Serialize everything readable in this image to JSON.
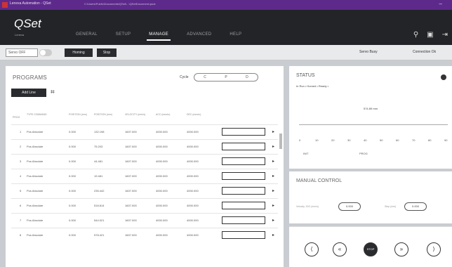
{
  "window": {
    "title": "Lenexa Automation - QSet",
    "path": "C:\\Users\\Public\\Documents\\QSet\\...\\QSetDocument.qsdx",
    "minimize": "–"
  },
  "header": {
    "logo": "QSet",
    "logo_sub": "Lenexa",
    "nav": [
      "GENERAL",
      "SETUP",
      "MANAGE",
      "ADVANCED",
      "HELP"
    ],
    "nav_active": "MANAGE"
  },
  "toolbar": {
    "servo": "Servo OFF",
    "buttons": [
      "Homing",
      "Stop"
    ],
    "servo_status": "Servo Busy",
    "connection": "Connection Ok"
  },
  "programs": {
    "title": "PROGRAMS",
    "cycle_label": "Cycle",
    "cycle_options": [
      "C",
      "P",
      "D"
    ],
    "add_button": "Add Line",
    "columns": [
      "PROG",
      "TYPE COMMAND",
      "POSITION (mm)",
      "POSITION (mm)",
      "VELOCITY (mm/s)",
      "ACC (mm/s²)",
      "DEC (mm/s²)"
    ],
    "rows": [
      [
        "1",
        "Pos Absolute",
        "0.000",
        "132.198",
        "1607.000",
        "4000.000",
        "4000.000"
      ],
      [
        "2",
        "Pos Absolute",
        "0.000",
        "75.203",
        "1607.000",
        "4000.000",
        "4000.000"
      ],
      [
        "3",
        "Pos Absolute",
        "0.000",
        "44.481",
        "1607.000",
        "4000.000",
        "4000.000"
      ],
      [
        "4",
        "Pos Absolute",
        "0.000",
        "19.481",
        "1607.000",
        "4000.000",
        "4000.000"
      ],
      [
        "5",
        "Pos Absolute",
        "0.000",
        "235.442",
        "1607.000",
        "4000.000",
        "4000.000"
      ],
      [
        "6",
        "Pos Absolute",
        "0.000",
        "518.814",
        "1607.000",
        "4000.000",
        "4000.000"
      ],
      [
        "7",
        "Pos Absolute",
        "0.000",
        "544.021",
        "1607.000",
        "4000.000",
        "4000.000"
      ],
      [
        "8",
        "Pos Absolute",
        "0.000",
        "578.421",
        "1607.000",
        "4000.000",
        "4000.000"
      ]
    ]
  },
  "status": {
    "title": "STATUS",
    "line": "In Run  •  Homed  •  Ready  •",
    "position_label": "574.89 mm",
    "ticks": [
      "0",
      "10",
      "20",
      "30",
      "40",
      "50",
      "60",
      "70",
      "80",
      "90"
    ],
    "legend_left": "INIT",
    "legend_right": "PROG"
  },
  "manual": {
    "title": "MANUAL CONTROL",
    "label_1": "Velocity JOG (mm/s)",
    "value_1": "0.000",
    "label_2": "Step (mm)",
    "value_2": "0.000"
  },
  "jog": {
    "buttons": [
      "⟨",
      "«",
      "STOP",
      "»",
      "⟩"
    ]
  }
}
